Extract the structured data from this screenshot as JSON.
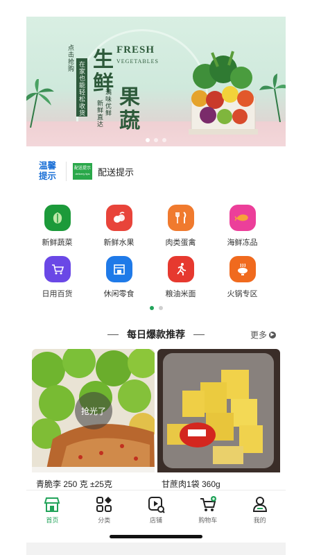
{
  "banner": {
    "cta": "点击抢购",
    "panel_text": "在家也能轻松收货",
    "big_char_1": "生",
    "big_char_2": "鲜",
    "big_char_3": "果",
    "big_char_4": "蔬",
    "fresh": "FRESH",
    "vegetables": "VEGETABLES",
    "tag_1": "新鲜直达",
    "tag_2": "满味优鲜",
    "slide_count": 3,
    "active_slide": 1
  },
  "notice": {
    "tip_label": "温馨提示",
    "logo_text_1": "配送提示",
    "logo_text_2": "delivery tips",
    "title": "配送提示"
  },
  "categories": [
    {
      "label": "新鲜蔬菜",
      "icon": "vegetable-icon",
      "color": "#1c9a3a"
    },
    {
      "label": "新鲜水果",
      "icon": "fruit-icon",
      "color": "#e8443a"
    },
    {
      "label": "肉类蛋禽",
      "icon": "cutlery-icon",
      "color": "#f07a2e"
    },
    {
      "label": "海鲜冻品",
      "icon": "shrimp-icon",
      "color": "#ec3f9a"
    },
    {
      "label": "日用百货",
      "icon": "cart-icon",
      "color": "#6a48e6"
    },
    {
      "label": "休闲零食",
      "icon": "store-icon",
      "color": "#1f7ae8"
    },
    {
      "label": "粮油米面",
      "icon": "runner-icon",
      "color": "#e6392f"
    },
    {
      "label": "火锅专区",
      "icon": "hotpot-icon",
      "color": "#f06a1e"
    }
  ],
  "category_pager": {
    "pages": 2,
    "active": 1
  },
  "section": {
    "title": "每日爆款推荐",
    "more": "更多"
  },
  "products": [
    {
      "name": "青脆李 250 克 ±25克",
      "badge": "抢光了"
    },
    {
      "name": "甘蔗肉1袋 360g",
      "badge": ""
    }
  ],
  "tabs": [
    {
      "label": "首页",
      "icon": "home-icon",
      "active": true
    },
    {
      "label": "分类",
      "icon": "category-icon",
      "active": false
    },
    {
      "label": "店铺",
      "icon": "store-play-icon",
      "active": false
    },
    {
      "label": "购物车",
      "icon": "cart-icon",
      "active": false
    },
    {
      "label": "我的",
      "icon": "user-icon",
      "active": false
    }
  ],
  "colors": {
    "accent": "#22a35a",
    "tip_blue": "#1a6fd6"
  }
}
